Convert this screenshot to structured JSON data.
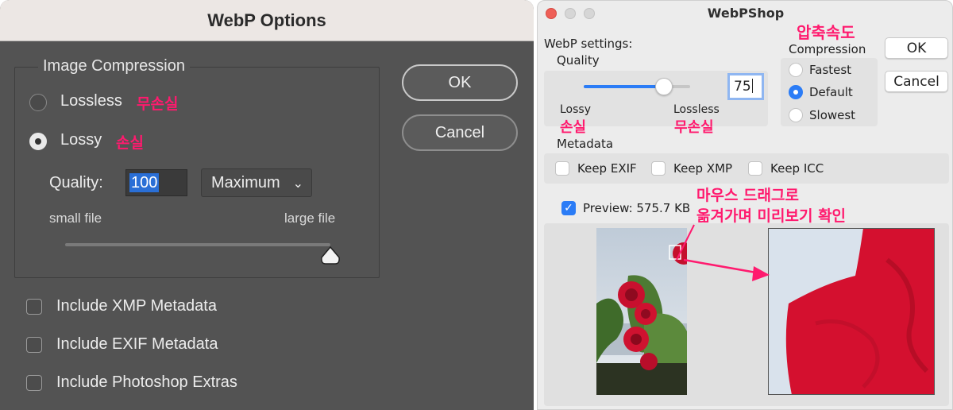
{
  "photoshop": {
    "title": "WebP Options",
    "group_title": "Image Compression",
    "lossless_label": "Lossless",
    "lossless_note": "무손실",
    "lossy_label": "Lossy",
    "lossy_note": "손실",
    "quality_label": "Quality:",
    "quality_value": "100",
    "preset_value": "Maximum",
    "small_file_label": "small file",
    "large_file_label": "large file",
    "slider_position": 1.0,
    "ok_label": "OK",
    "cancel_label": "Cancel",
    "checkboxes": [
      {
        "label": "Include XMP Metadata",
        "checked": false
      },
      {
        "label": "Include EXIF Metadata",
        "checked": false
      },
      {
        "label": "Include Photoshop Extras",
        "checked": false
      }
    ]
  },
  "webpshop": {
    "title": "WebPShop",
    "settings_label": "WebP settings:",
    "quality_label": "Quality",
    "quality_value": "75",
    "quality_fraction": 0.75,
    "lossy_label": "Lossy",
    "lossy_note": "손실",
    "lossless_label": "Lossless",
    "lossless_note": "무손실",
    "compression_note": "압축속도",
    "compression_label": "Compression",
    "compression_options": [
      "Fastest",
      "Default",
      "Slowest"
    ],
    "compression_selected": "Default",
    "metadata_label": "Metadata",
    "keep_exif_label": "Keep EXIF",
    "keep_xmp_label": "Keep XMP",
    "keep_icc_label": "Keep ICC",
    "preview_label": "Preview: 575.7 KB",
    "preview_checked": true,
    "drag_note_line1": "마우스 드래그로",
    "drag_note_line2": "옮겨가며 미리보기 확인",
    "ok_label": "OK",
    "cancel_label": "Cancel"
  },
  "colors": {
    "annotation": "#ff1a6e",
    "accent": "#2b7cf6",
    "photoshop_bg": "#535353"
  }
}
